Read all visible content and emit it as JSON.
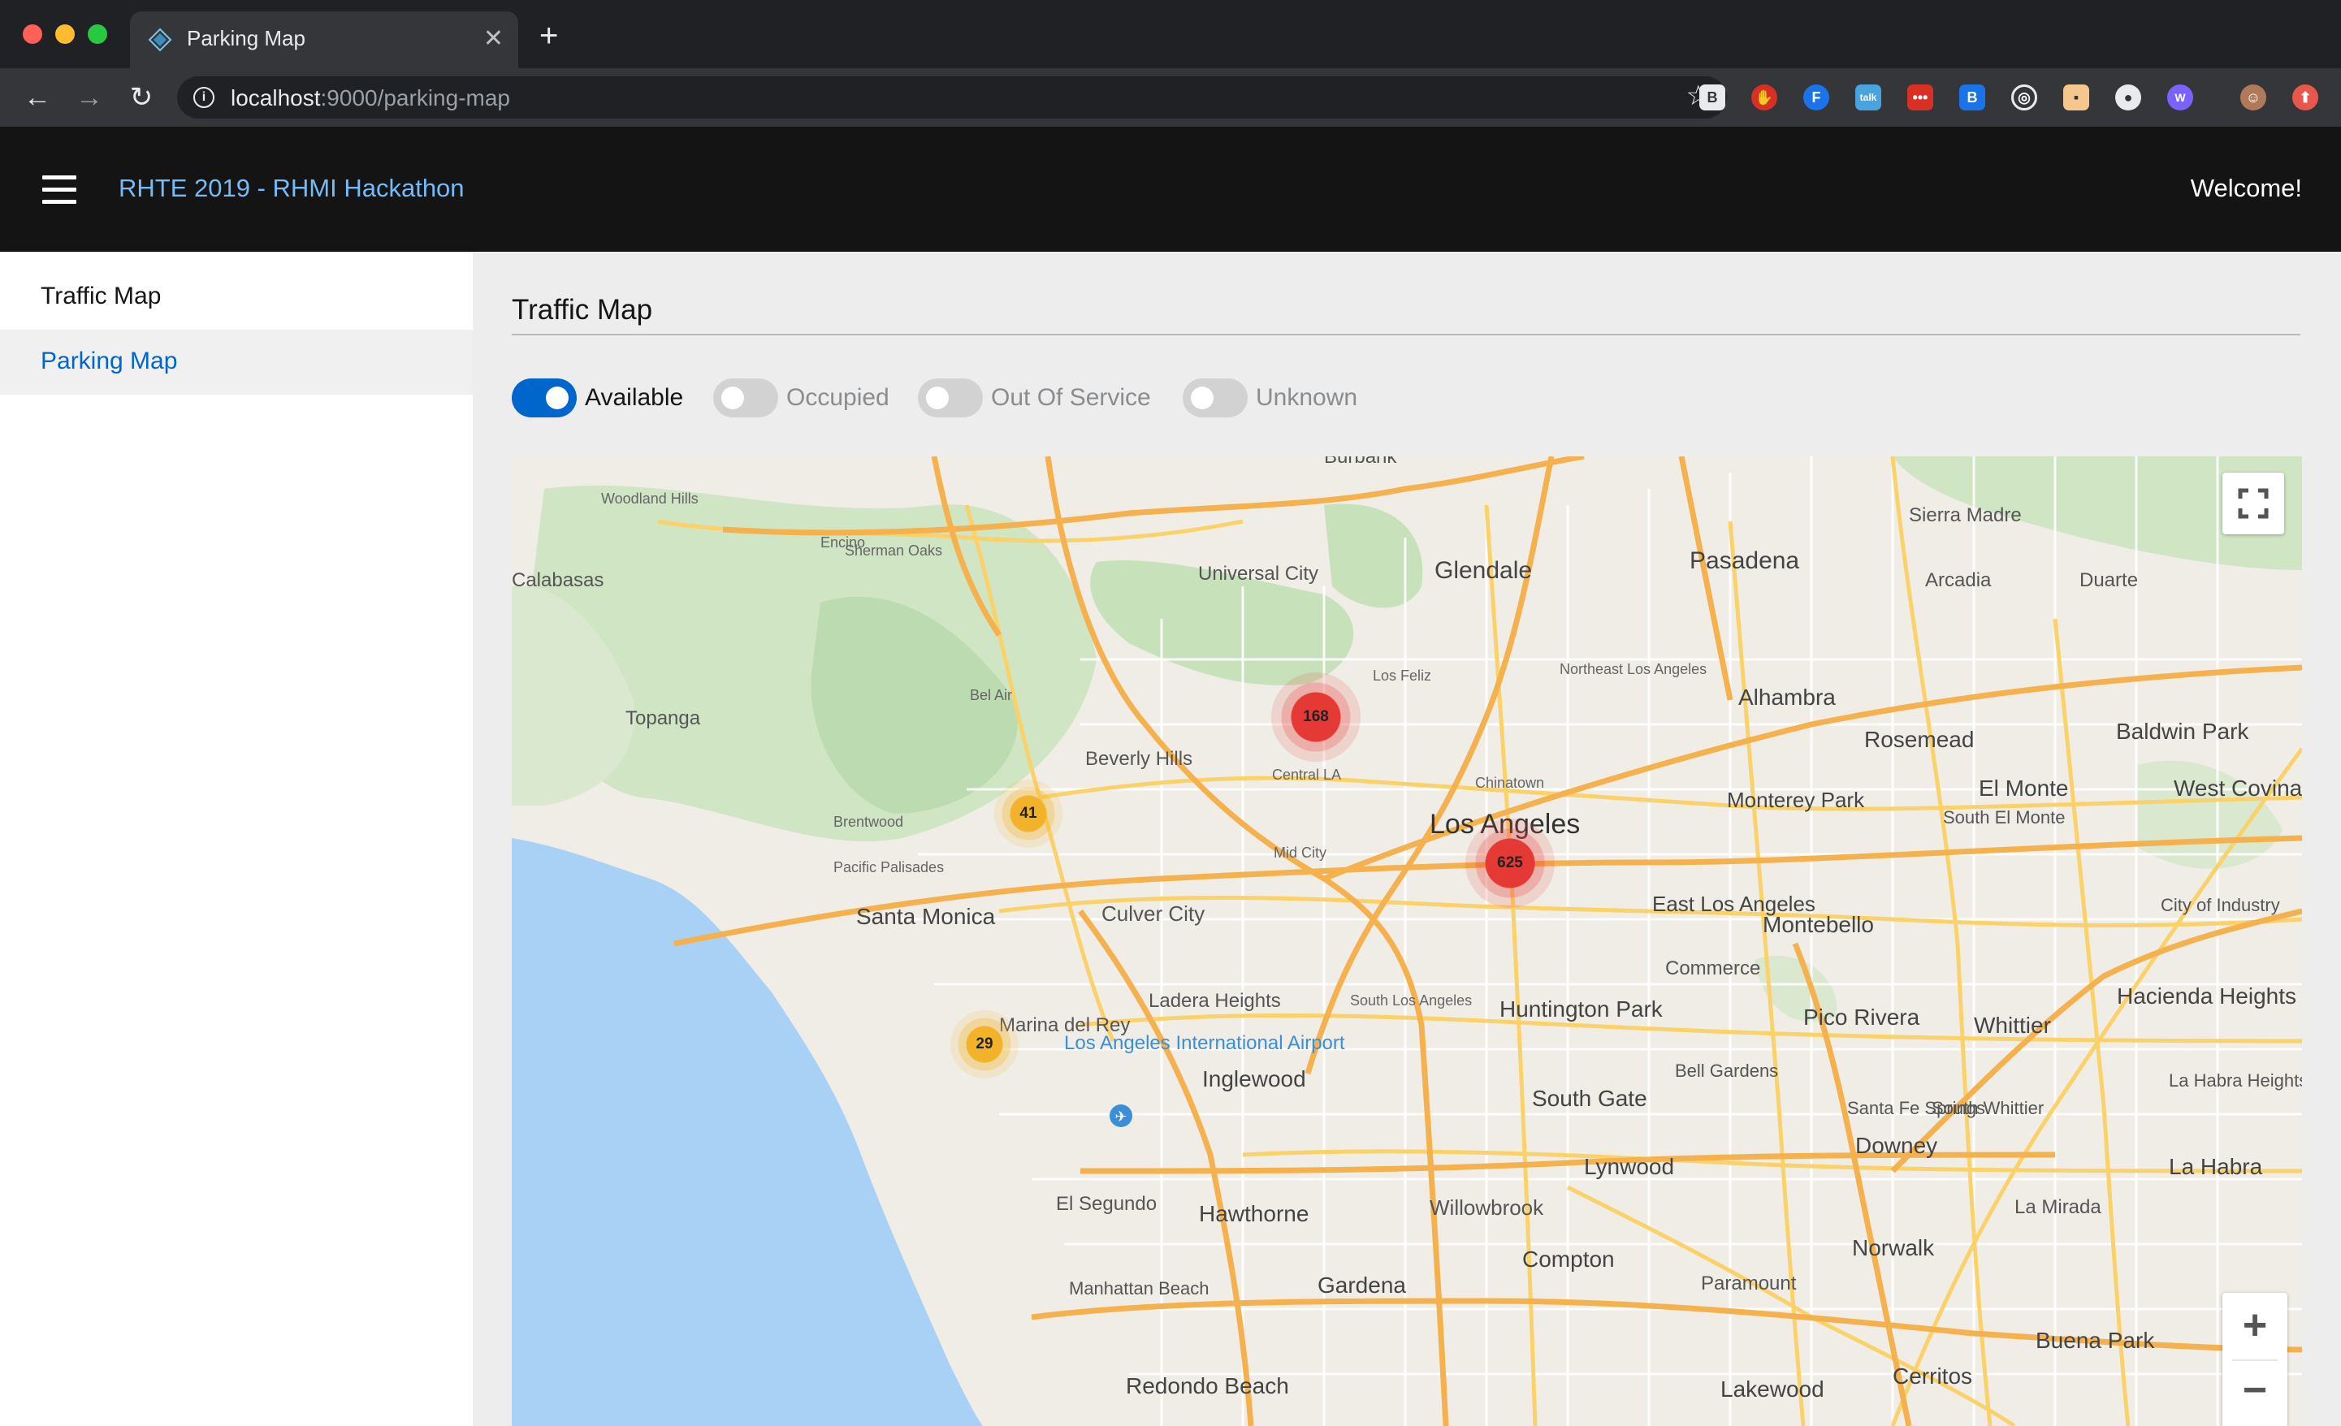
{
  "browser": {
    "tab_title": "Parking Map",
    "url_host": "localhost",
    "url_path": ":9000/parking-map"
  },
  "header": {
    "title": "RHTE 2019 - RHMI Hackathon",
    "welcome": "Welcome!"
  },
  "sidebar": {
    "items": [
      {
        "label": "Traffic Map"
      },
      {
        "label": "Parking Map"
      }
    ]
  },
  "main": {
    "title": "Traffic Map",
    "filters": [
      {
        "label": "Available",
        "on": true
      },
      {
        "label": "Occupied",
        "on": false
      },
      {
        "label": "Out Of Service",
        "on": false
      },
      {
        "label": "Unknown",
        "on": false
      }
    ]
  },
  "map": {
    "clusters": [
      {
        "count": "168",
        "color": "#e53935"
      },
      {
        "count": "625",
        "color": "#e53935"
      },
      {
        "count": "41",
        "color": "#f2b32b"
      },
      {
        "count": "29",
        "color": "#f2b32b"
      }
    ],
    "places": [
      "Burbank",
      "Woodland Hills",
      "Encino",
      "Sherman Oaks",
      "Universal City",
      "Glendale",
      "Pasadena",
      "Sierra Madre",
      "Arcadia",
      "Duarte",
      "Calabasas",
      "Topanga",
      "Bel Air",
      "Los Feliz",
      "Northeast Los Angeles",
      "Alhambra",
      "Rosemead",
      "Baldwin Park",
      "Beverly Hills",
      "Central LA",
      "Chinatown",
      "Los Angeles",
      "Monterey Park",
      "El Monte",
      "West Covina",
      "Brentwood",
      "South El Monte",
      "Pacific Palisades",
      "Mid City",
      "Santa Monica",
      "Culver City",
      "East Los Angeles",
      "Montebello",
      "City of Industry",
      "Commerce",
      "Ladera Heights",
      "South Los Angeles",
      "Huntington Park",
      "Pico Rivera",
      "Hacienda Heights",
      "Whittier",
      "Marina del Rey",
      "Los Angeles International Airport",
      "Inglewood",
      "Bell Gardens",
      "La Habra Heights",
      "South Gate",
      "Santa Fe Springs",
      "South Whittier",
      "Downey",
      "La Habra",
      "El Segundo",
      "Hawthorne",
      "Lynwood",
      "Willowbrook",
      "La Mirada",
      "Norwalk",
      "Compton",
      "Paramount",
      "Manhattan Beach",
      "Gardena",
      "Buena Park",
      "Redondo Beach",
      "Lakewood",
      "Cerritos"
    ],
    "controls": {
      "zoom_in": "+",
      "zoom_out": "−"
    }
  }
}
